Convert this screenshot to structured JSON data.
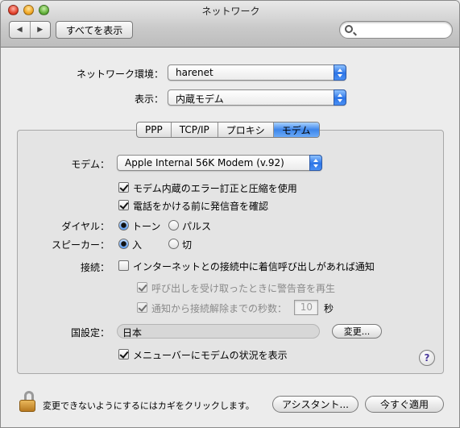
{
  "window": {
    "title": "ネットワーク"
  },
  "toolbar": {
    "back_glyph": "◀",
    "forward_glyph": "▶",
    "show_all_label": "すべてを表示",
    "search_placeholder": ""
  },
  "location": {
    "label": "ネットワーク環境：",
    "value": "harenet"
  },
  "show": {
    "label": "表示：",
    "value": "内蔵モデム"
  },
  "tabs": [
    {
      "label": "PPP",
      "active": false
    },
    {
      "label": "TCP/IP",
      "active": false
    },
    {
      "label": "プロキシ",
      "active": false
    },
    {
      "label": "モデム",
      "active": true
    }
  ],
  "modem": {
    "label": "モデム：",
    "value": "Apple Internal 56K Modem (v.92)",
    "error_correction_label": "モデム内蔵のエラー訂正と圧縮を使用",
    "error_correction_checked": true,
    "dial_tone_label": "電話をかける前に発信音を確認",
    "dial_tone_checked": true,
    "dialing_label": "ダイヤル：",
    "tone_label": "トーン",
    "pulse_label": "パルス",
    "dialing_selected": "トーン",
    "speaker_label": "スピーカー：",
    "speaker_on_label": "入",
    "speaker_off_label": "切",
    "speaker_selected": "入",
    "connection_label": "接続：",
    "notify_label": "インターネットとの接続中に着信呼び出しがあれば通知",
    "notify_checked": false,
    "alert_sound_label": "呼び出しを受け取ったときに警告音を再生",
    "alert_sound_checked": true,
    "seconds_label": "通知から接続解除までの秒数：",
    "seconds_checked": true,
    "seconds_value": "10",
    "seconds_unit": "秒",
    "country_label": "国設定：",
    "country_value": "日本",
    "change_button": "変更...",
    "menubar_label": "メニューバーにモデムの状況を表示",
    "menubar_checked": true,
    "help_glyph": "?"
  },
  "footer": {
    "lock_text": "変更できないようにするにはカギをクリックします。",
    "assistant_button": "アシスタント...",
    "apply_button": "今すぐ適用"
  },
  "colors": {
    "accent": "#3d86ea",
    "window_bg": "#ececec"
  }
}
